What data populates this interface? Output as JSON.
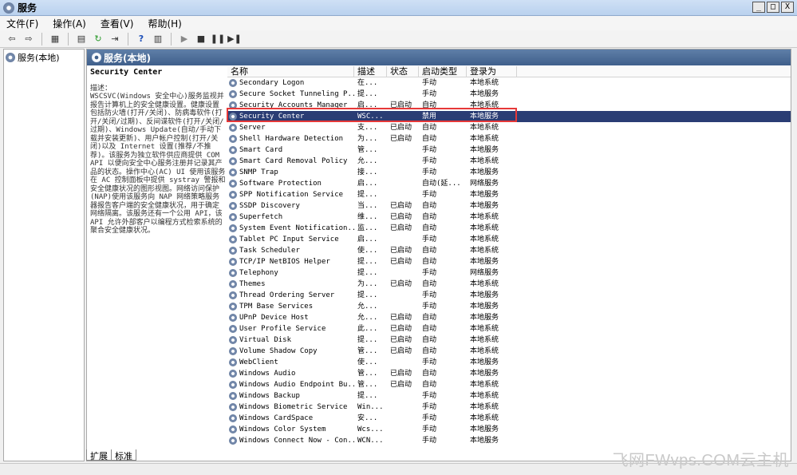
{
  "window": {
    "title": "服务",
    "min": "_",
    "max": "□",
    "close": "X"
  },
  "menu": [
    "文件(F)",
    "操作(A)",
    "查看(V)",
    "帮助(H)"
  ],
  "tree": {
    "root": "服务(本地)"
  },
  "main": {
    "header": "服务(本地)",
    "selected_service": "Security Center",
    "description_label": "描述：",
    "description": "WSCSVC(Windows 安全中心)服务监视并报告计算机上的安全健康设置。健康设置包括防火墙(打开/关闭)、防病毒软件(打开/关闭/过期)、反间谍软件(打开/关闭/过期)、Windows Update(自动/手动下载并安装更新)、用户帐户控制(打开/关闭)以及 Internet 设置(推荐/不推荐)。该服务为独立软件供应商提供 COM API 以便向安全中心服务注册并记录其产品的状态。操作中心(AC) UI 使用该服务在 AC 控制面板中提供 systray 警报和安全健康状况的图形视图。网络访问保护(NAP)使用该服务向 NAP 网络策略服务器报告客户端的安全健康状况，用于确定网络隔离。该服务还有一个公用 API，该 API 允许外部客户以编程方式检索系统的聚合安全健康状况。"
  },
  "columns": {
    "name": "名称",
    "desc": "描述",
    "status": "状态",
    "start": "启动类型",
    "logon": "登录为"
  },
  "services": [
    {
      "name": "Secondary Logon",
      "desc": "在...",
      "status": "",
      "start": "手动",
      "logon": "本地系统"
    },
    {
      "name": "Secure Socket Tunneling P...",
      "desc": "提...",
      "status": "",
      "start": "手动",
      "logon": "本地服务"
    },
    {
      "name": "Security Accounts Manager",
      "desc": "启...",
      "status": "已启动",
      "start": "自动",
      "logon": "本地系统"
    },
    {
      "name": "Security Center",
      "desc": "WSC...",
      "status": "",
      "start": "禁用",
      "logon": "本地服务",
      "selected": true
    },
    {
      "name": "Server",
      "desc": "支...",
      "status": "已启动",
      "start": "自动",
      "logon": "本地系统"
    },
    {
      "name": "Shell Hardware Detection",
      "desc": "为...",
      "status": "已启动",
      "start": "自动",
      "logon": "本地系统"
    },
    {
      "name": "Smart Card",
      "desc": "管...",
      "status": "",
      "start": "手动",
      "logon": "本地服务"
    },
    {
      "name": "Smart Card Removal Policy",
      "desc": "允...",
      "status": "",
      "start": "手动",
      "logon": "本地系统"
    },
    {
      "name": "SNMP Trap",
      "desc": "接...",
      "status": "",
      "start": "手动",
      "logon": "本地服务"
    },
    {
      "name": "Software Protection",
      "desc": "启...",
      "status": "",
      "start": "自动(延...",
      "logon": "网络服务"
    },
    {
      "name": "SPP Notification Service",
      "desc": "提...",
      "status": "",
      "start": "手动",
      "logon": "本地服务"
    },
    {
      "name": "SSDP Discovery",
      "desc": "当...",
      "status": "已启动",
      "start": "自动",
      "logon": "本地服务"
    },
    {
      "name": "Superfetch",
      "desc": "维...",
      "status": "已启动",
      "start": "自动",
      "logon": "本地系统"
    },
    {
      "name": "System Event Notification...",
      "desc": "监...",
      "status": "已启动",
      "start": "自动",
      "logon": "本地系统"
    },
    {
      "name": "Tablet PC Input Service",
      "desc": "启...",
      "status": "",
      "start": "手动",
      "logon": "本地系统"
    },
    {
      "name": "Task Scheduler",
      "desc": "使...",
      "status": "已启动",
      "start": "自动",
      "logon": "本地系统"
    },
    {
      "name": "TCP/IP NetBIOS Helper",
      "desc": "提...",
      "status": "已启动",
      "start": "自动",
      "logon": "本地服务"
    },
    {
      "name": "Telephony",
      "desc": "提...",
      "status": "",
      "start": "手动",
      "logon": "网络服务"
    },
    {
      "name": "Themes",
      "desc": "为...",
      "status": "已启动",
      "start": "自动",
      "logon": "本地系统"
    },
    {
      "name": "Thread Ordering Server",
      "desc": "提...",
      "status": "",
      "start": "手动",
      "logon": "本地服务"
    },
    {
      "name": "TPM Base Services",
      "desc": "允...",
      "status": "",
      "start": "手动",
      "logon": "本地服务"
    },
    {
      "name": "UPnP Device Host",
      "desc": "允...",
      "status": "已启动",
      "start": "自动",
      "logon": "本地服务"
    },
    {
      "name": "User Profile Service",
      "desc": "此...",
      "status": "已启动",
      "start": "自动",
      "logon": "本地系统"
    },
    {
      "name": "Virtual Disk",
      "desc": "提...",
      "status": "已启动",
      "start": "自动",
      "logon": "本地系统"
    },
    {
      "name": "Volume Shadow Copy",
      "desc": "管...",
      "status": "已启动",
      "start": "自动",
      "logon": "本地系统"
    },
    {
      "name": "WebClient",
      "desc": "使...",
      "status": "",
      "start": "手动",
      "logon": "本地服务"
    },
    {
      "name": "Windows Audio",
      "desc": "管...",
      "status": "已启动",
      "start": "自动",
      "logon": "本地服务"
    },
    {
      "name": "Windows Audio Endpoint Bu...",
      "desc": "管...",
      "status": "已启动",
      "start": "自动",
      "logon": "本地系统"
    },
    {
      "name": "Windows Backup",
      "desc": "提...",
      "status": "",
      "start": "手动",
      "logon": "本地系统"
    },
    {
      "name": "Windows Biometric Service",
      "desc": "Win...",
      "status": "",
      "start": "手动",
      "logon": "本地系统"
    },
    {
      "name": "Windows CardSpace",
      "desc": "安...",
      "status": "",
      "start": "手动",
      "logon": "本地系统"
    },
    {
      "name": "Windows Color System",
      "desc": "Wcs...",
      "status": "",
      "start": "手动",
      "logon": "本地服务"
    },
    {
      "name": "Windows Connect Now - Con...",
      "desc": "WCN...",
      "status": "",
      "start": "手动",
      "logon": "本地服务"
    }
  ],
  "tabs": [
    "扩展",
    "标准"
  ],
  "watermark": "飞网FWvps.COM云主机"
}
